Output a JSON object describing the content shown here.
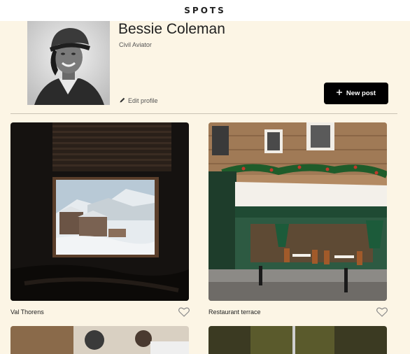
{
  "app": {
    "logo": "SPOTS"
  },
  "profile": {
    "name": "Bessie Coleman",
    "description": "Civil Aviator",
    "edit_label": "Edit profile",
    "new_post_label": "New post"
  },
  "cards": [
    {
      "title": "Val Thorens"
    },
    {
      "title": "Restaurant terrace"
    }
  ]
}
